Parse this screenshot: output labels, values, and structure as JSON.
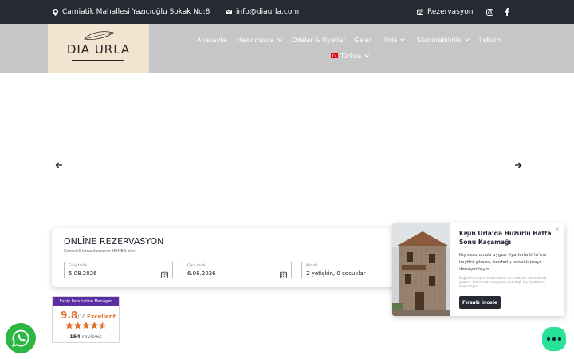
{
  "topbar": {
    "address": "Camiatik Mahallesi Yazıcıoğlu Sokak No:8",
    "email": "info@diaurla.com",
    "reservation": "Rezervasyon",
    "icons": [
      "map-pin-icon",
      "envelope-icon",
      "calendar-check-icon",
      "instagram-icon",
      "facebook-icon"
    ]
  },
  "logo": {
    "text": "DIA URLA"
  },
  "nav": {
    "items": [
      "Anasayfa",
      "Hakkımızda",
      "Odalar & Fiyatlar",
      "Galeri",
      "Urla",
      "Sürdürebilirlik",
      "İletişim"
    ],
    "language": "Türkçe"
  },
  "reservation": {
    "title": "ONLİNE REZERVASYON",
    "subtitle_prefix": "Garantili konaklamanızı",
    "subtitle_emphasis": "HEMEN alın!",
    "checkin": {
      "label": "Giriş tarihi",
      "value": "5.08.2026"
    },
    "checkout": {
      "label": "Çıkış tarihi",
      "value": "6.08.2026"
    },
    "guests": {
      "label": "Misafir",
      "value": "2 yetişkin, 0 çocuklar"
    }
  },
  "promo": {
    "title": "Kışın Urla’da Huzurlu Hafta Sonu Kaçamağı",
    "body": "Kış sezonunda uygun fiyatlarla Urla’nın keyfini çıkarın, konforlu konaklamayı deneyimleyin.",
    "small": "Soğuk havaların tadını sakin ve sıcak bir atmosferde çıkarın. Erken rezervasyonla avantajlı kış fiyatlarını kaçırmayın.",
    "button": "Fırsatı İncele",
    "close": "×"
  },
  "reputation": {
    "header": "Exely Reputation Manager",
    "score": "9.8",
    "max": "/10",
    "word": "Excellent",
    "stars": 4.5,
    "count": "154",
    "count_suffix": "reviews"
  },
  "colors": {
    "topbar": "#272a33",
    "navbar": "#c6c6c6",
    "logo_bg": "#f3e4d2",
    "reputation_header": "#5b2fa4",
    "score": "#e0702b",
    "whatsapp": "#2bb741",
    "chat": "#27e39a"
  }
}
